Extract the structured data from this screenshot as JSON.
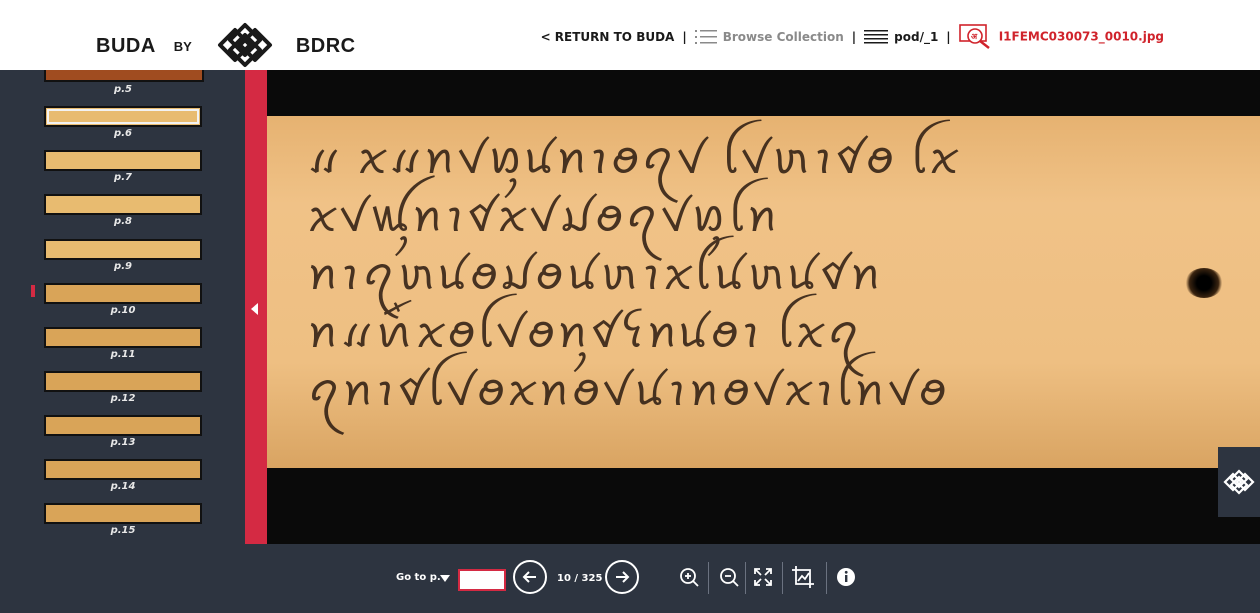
{
  "header": {
    "brand_left": "BUDA",
    "brand_by": "BY",
    "brand_right": "BDRC",
    "return_label": "< RETURN TO BUDA",
    "browse_label": "Browse Collection",
    "volume_label": "pod/_1",
    "file_label": "I1FEMC030073_0010.jpg",
    "separator": "|"
  },
  "sidebar": {
    "pages": [
      {
        "label": "p.5"
      },
      {
        "label": "p.6"
      },
      {
        "label": "p.7"
      },
      {
        "label": "p.8"
      },
      {
        "label": "p.9"
      },
      {
        "label": "p.10"
      },
      {
        "label": "p.11"
      },
      {
        "label": "p.12"
      },
      {
        "label": "p.13"
      },
      {
        "label": "p.14"
      },
      {
        "label": "p.15"
      }
    ],
    "current_page": "p.10"
  },
  "viewer": {
    "image_file": "I1FEMC030073_0010.jpg"
  },
  "bottombar": {
    "goto_label": "Go to p.",
    "goto_value": "",
    "page_counter": "10 / 325"
  },
  "colors": {
    "accent": "#d42a43",
    "panel": "#2d3440",
    "file_link": "#d0232b"
  }
}
